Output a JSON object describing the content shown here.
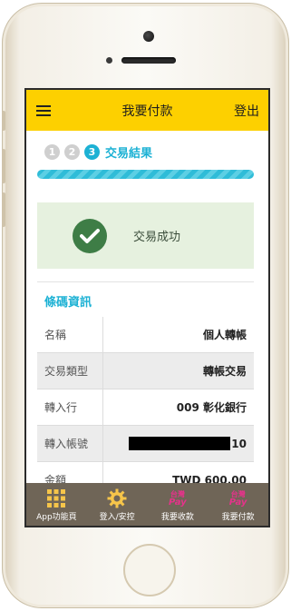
{
  "header": {
    "title": "我要付款",
    "logout_label": "登出"
  },
  "steps": {
    "items": [
      "1",
      "2",
      "3"
    ],
    "current_label": "交易結果"
  },
  "result": {
    "message": "交易成功"
  },
  "section": {
    "title": "條碼資訊"
  },
  "details": [
    {
      "label": "名稱",
      "value": "個人轉帳"
    },
    {
      "label": "交易類型",
      "value": "轉帳交易"
    },
    {
      "label": "轉入行",
      "value": "009 彰化銀行"
    },
    {
      "label": "轉入帳號",
      "value": "10"
    },
    {
      "label": "金額",
      "value": "TWD 600.00"
    }
  ],
  "tabbar": {
    "items": [
      {
        "label": "App功能頁",
        "icon": "grid-icon"
      },
      {
        "label": "登入/安控",
        "icon": "gear-icon"
      },
      {
        "label": "我要收款",
        "icon": "taiwan-pay-icon"
      },
      {
        "label": "我要付款",
        "icon": "taiwan-pay-icon"
      }
    ],
    "pay_logo": {
      "top": "台灣",
      "bottom": "Pay"
    }
  },
  "colors": {
    "header": "#fdd000",
    "accent": "#1cb1d4",
    "success_bg": "#e6f1df",
    "check": "#3e7d46",
    "tabbar": "#6f6557",
    "pay": "#e4338a"
  }
}
